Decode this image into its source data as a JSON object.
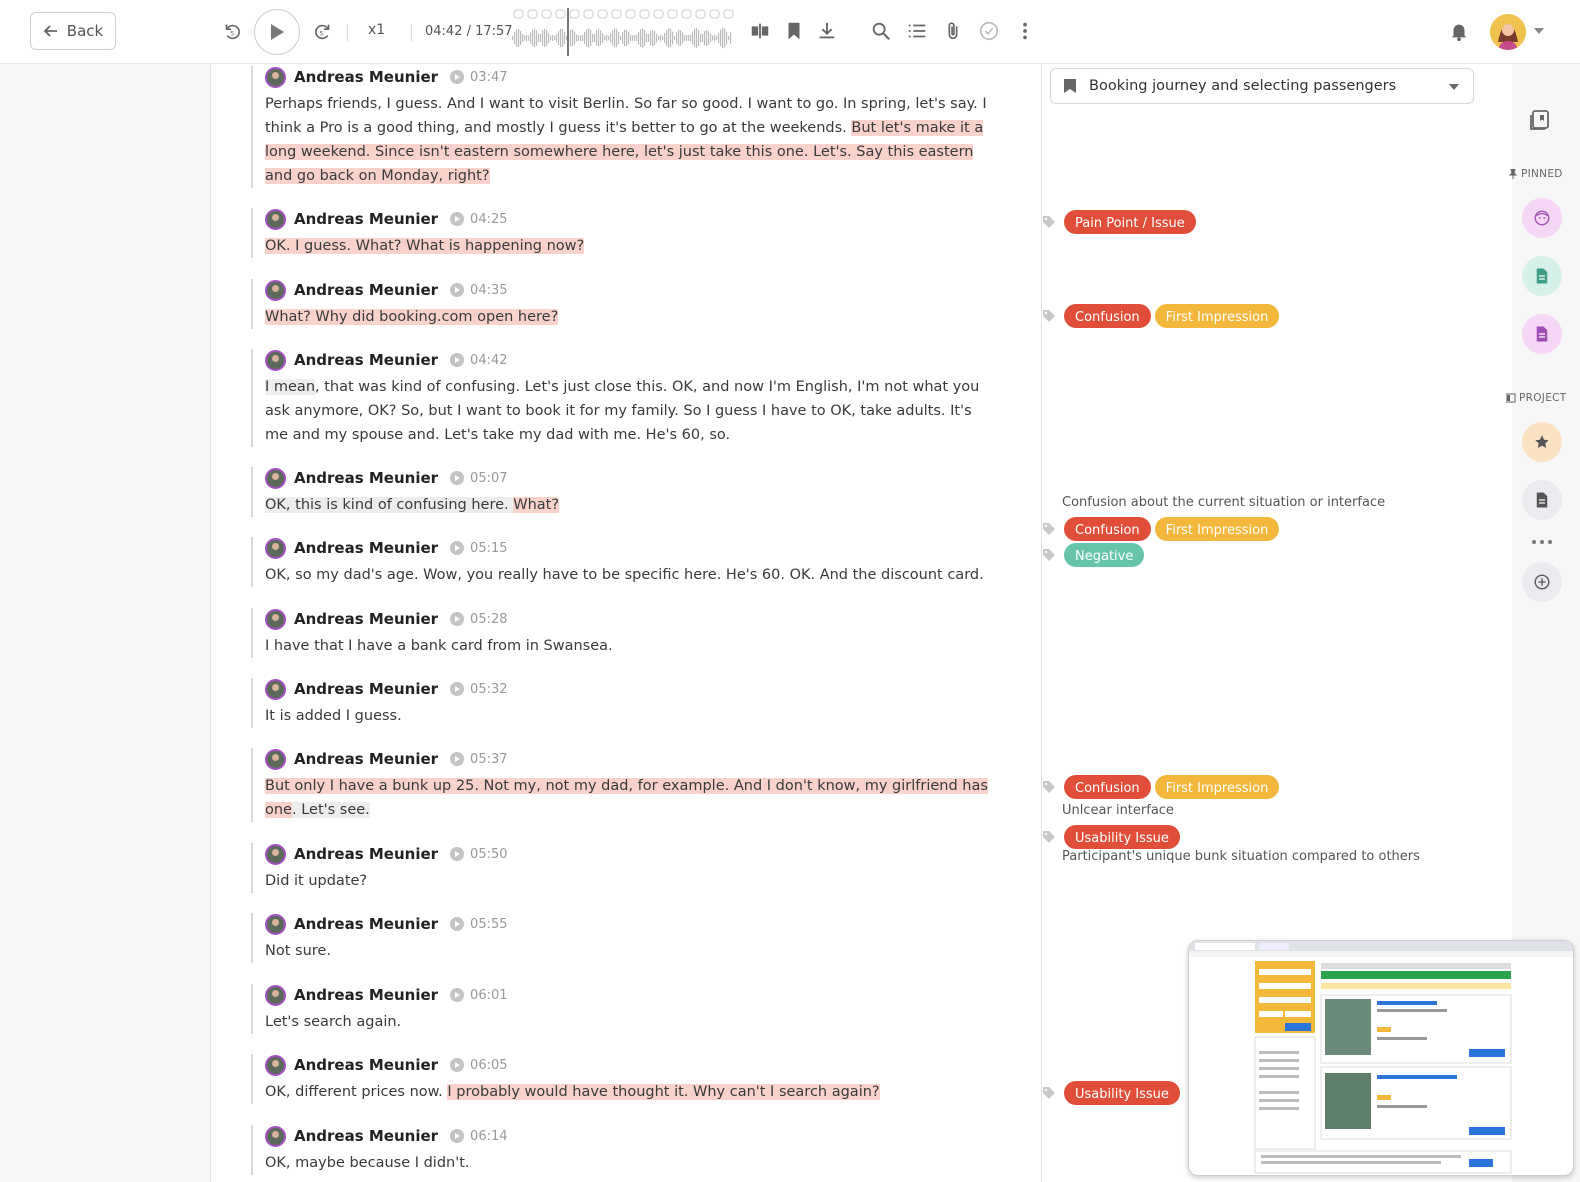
{
  "toolbar": {
    "back_label": "Back",
    "speed": "x1",
    "time": "04:42 / 17:57"
  },
  "section": {
    "selected": "Booking journey and selecting passengers"
  },
  "rail": {
    "pinned_label": "PINNED",
    "project_label": "PROJECT"
  },
  "entries": [
    {
      "speaker": "Andreas Meunier",
      "time": "03:47",
      "parts": [
        {
          "t": "Perhaps friends, I guess. And I want to visit Berlin. So far so good. I want to go. In spring, let's say. I think a Pro is a good thing, and mostly I guess it's better to go at the weekends. ",
          "h": ""
        },
        {
          "t": "But let's make it a long weekend. Since isn't eastern somewhere here, let's just take this one. Let's. Say this eastern and go back on Monday, right?",
          "h": "hl"
        }
      ]
    },
    {
      "speaker": "Andreas Meunier",
      "time": "04:25",
      "parts": [
        {
          "t": "OK. I guess. What? What is happening now?",
          "h": "hl"
        }
      ]
    },
    {
      "speaker": "Andreas Meunier",
      "time": "04:35",
      "parts": [
        {
          "t": "What? Why did booking.com open here?",
          "h": "hl"
        }
      ]
    },
    {
      "speaker": "Andreas Meunier",
      "time": "04:42",
      "parts": [
        {
          "t": "I mean",
          "h": "hlg"
        },
        {
          "t": ", that was kind of confusing. Let's just close this. OK, and now I'm English, I'm not what you ask anymore, OK? So, but I want to book it for my family. So I guess I have to OK, take adults. It's me and my spouse and. Let's take my dad with me. He's 60, so.",
          "h": ""
        }
      ]
    },
    {
      "speaker": "Andreas Meunier",
      "time": "05:07",
      "parts": [
        {
          "t": "OK, this is kind of confusing here. ",
          "h": "hlg"
        },
        {
          "t": "What?",
          "h": "hl"
        }
      ]
    },
    {
      "speaker": "Andreas Meunier",
      "time": "05:15",
      "parts": [
        {
          "t": "OK, so my dad's age. Wow, you really have to be specific here. He's 60. OK. And the discount card.",
          "h": ""
        }
      ]
    },
    {
      "speaker": "Andreas Meunier",
      "time": "05:28",
      "parts": [
        {
          "t": "I have that I have a bank card from in Swansea.",
          "h": ""
        }
      ]
    },
    {
      "speaker": "Andreas Meunier",
      "time": "05:32",
      "parts": [
        {
          "t": "It is added I guess.",
          "h": ""
        }
      ]
    },
    {
      "speaker": "Andreas Meunier",
      "time": "05:37",
      "parts": [
        {
          "t": "But only I have a bunk up 25. Not my, not my dad, for example. And I don't know, my girlfriend has one",
          "h": "hl"
        },
        {
          "t": ". Let's see.",
          "h": "hlg"
        }
      ]
    },
    {
      "speaker": "Andreas Meunier",
      "time": "05:50",
      "parts": [
        {
          "t": "Did it update?",
          "h": ""
        }
      ]
    },
    {
      "speaker": "Andreas Meunier",
      "time": "05:55",
      "parts": [
        {
          "t": "Not sure.",
          "h": ""
        }
      ]
    },
    {
      "speaker": "Andreas Meunier",
      "time": "06:01",
      "parts": [
        {
          "t": "Let's search again.",
          "h": ""
        }
      ]
    },
    {
      "speaker": "Andreas Meunier",
      "time": "06:05",
      "parts": [
        {
          "t": "OK, different prices now. ",
          "h": ""
        },
        {
          "t": "I probably would have thought it. Why can't I search again?",
          "h": "hl"
        }
      ]
    },
    {
      "speaker": "Andreas Meunier",
      "time": "06:14",
      "parts": [
        {
          "t": "OK, maybe because I didn't.",
          "h": ""
        }
      ]
    }
  ],
  "tag_rows": [
    {
      "pills": [
        {
          "label": "Pain Point / Issue",
          "color": "#e04e3a"
        }
      ]
    },
    {
      "pills": [
        {
          "label": "Confusion",
          "color": "#e04e3a"
        },
        {
          "label": "First Impression",
          "color": "#f3b73c"
        }
      ]
    },
    {
      "pills": [
        {
          "label": "Confusion",
          "color": "#e04e3a"
        },
        {
          "label": "First Impression",
          "color": "#f3b73c"
        }
      ]
    },
    {
      "pills": [
        {
          "label": "Negative",
          "color": "#66c4aa"
        }
      ]
    },
    {
      "pills": [
        {
          "label": "Confusion",
          "color": "#e04e3a"
        },
        {
          "label": "First Impression",
          "color": "#f3b73c"
        }
      ]
    },
    {
      "pills": [
        {
          "label": "Usability Issue",
          "color": "#e04e3a"
        }
      ]
    },
    {
      "pills": [
        {
          "label": "Usability Issue",
          "color": "#e04e3a"
        }
      ]
    }
  ],
  "notes": [
    "Confusion about the current situation or interface",
    "Unlcear interface",
    "Participant's unique bunk situation compared to others"
  ]
}
